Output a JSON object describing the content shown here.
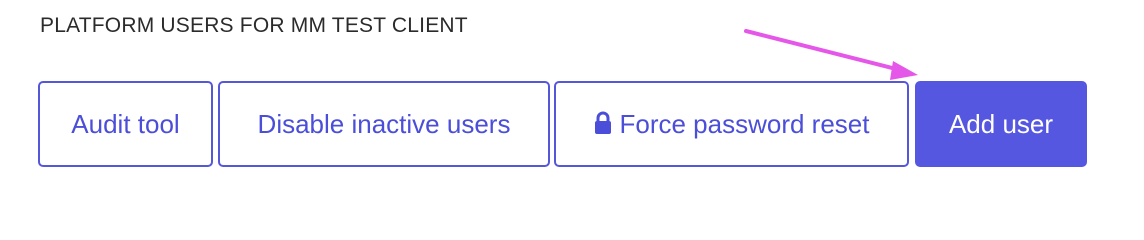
{
  "header": {
    "title": "PLATFORM USERS FOR MM TEST CLIENT"
  },
  "toolbar": {
    "audit_label": "Audit tool",
    "disable_label": "Disable inactive users",
    "force_reset_label": "Force password reset",
    "force_reset_icon": "lock-icon",
    "add_user_label": "Add user"
  },
  "colors": {
    "accent": "#5557e0",
    "annotation_arrow": "#e557e8"
  }
}
